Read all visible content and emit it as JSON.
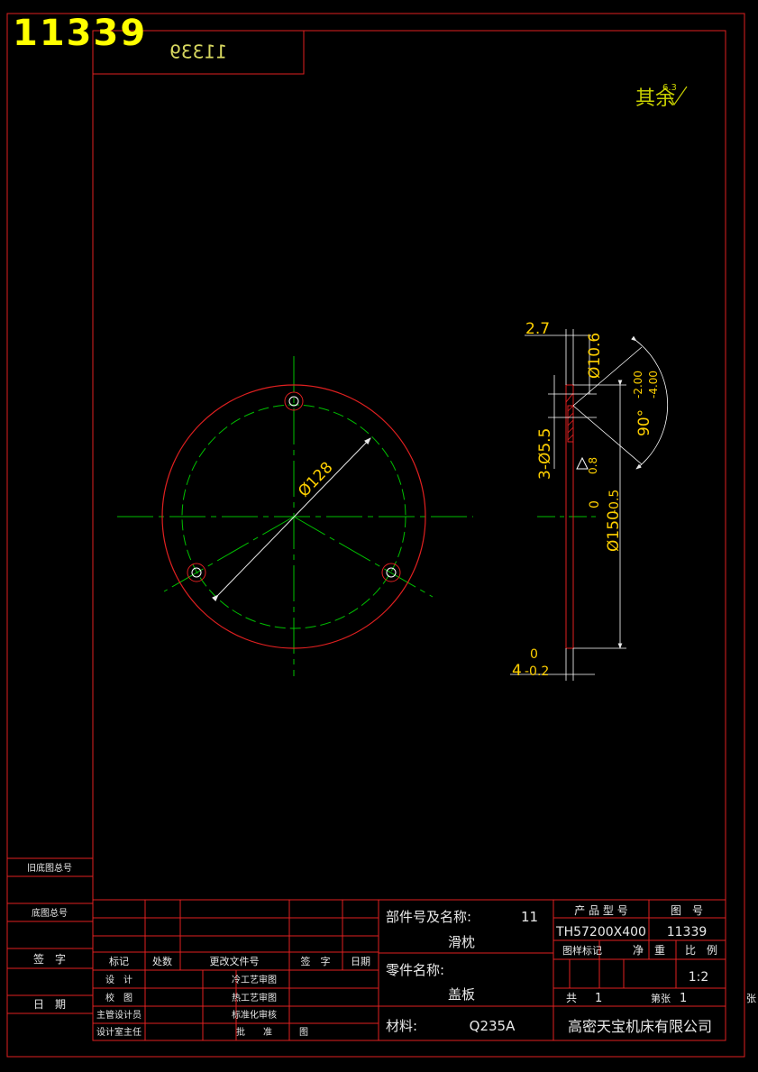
{
  "drawing_number_banner": "11339",
  "mirrored_number": "11339",
  "surface_note": {
    "label": "其余",
    "value": "6.3"
  },
  "dimensions": {
    "hole_pattern_dia": "Ø128",
    "thickness_top": "2.7",
    "chamfer_dia": "Ø10.6",
    "chamfer_tol_upper": "-2.00",
    "chamfer_tol_lower": "-4.00",
    "chamfer_angle": "90°",
    "holes": "3-Ø5.5",
    "roughness_0_8": "0.8",
    "outer_dia": "Ø150",
    "outer_dia_tol_upper": "0",
    "outer_dia_tol_lower": "-0.5",
    "thickness": "4",
    "thickness_tol_upper": "0",
    "thickness_tol_lower": "-0.2"
  },
  "side_column": {
    "old_drawing_no": "旧底图总号",
    "base_drawing_no": "底图总号",
    "signature": "签　字",
    "date": "日　期"
  },
  "title_block": {
    "rev_headers": [
      "标记",
      "处数",
      "更改文件号",
      "签　字",
      "日期"
    ],
    "role_rows": [
      {
        "left": "设　计",
        "right": "冷工艺审图"
      },
      {
        "left": "校　图",
        "right": "热工艺审图"
      },
      {
        "left": "主管设计员",
        "right": "标准化审核"
      },
      {
        "left": "设计室主任",
        "right": "批　　准"
      }
    ],
    "extra_cell": "图",
    "component_label": "部件号及名称:",
    "component_no": "11",
    "component_name": "滑枕",
    "part_label": "零件名称:",
    "part_name": "盖板",
    "material_label": "材料:",
    "material": "Q235A",
    "product_model_label": "产 品 型 号",
    "drawing_no_label": "图　号",
    "product_model": "TH57200X400",
    "drawing_no": "11339",
    "marking_label": "图样标记",
    "weight_label": "净　重",
    "scale_label": "比　例",
    "scale": "1:2",
    "total_label": "共",
    "total_sheets": "1",
    "sheet_label": "第张",
    "sheet_no": "1",
    "sheet_suffix": "张",
    "company": "高密天宝机床有限公司"
  }
}
